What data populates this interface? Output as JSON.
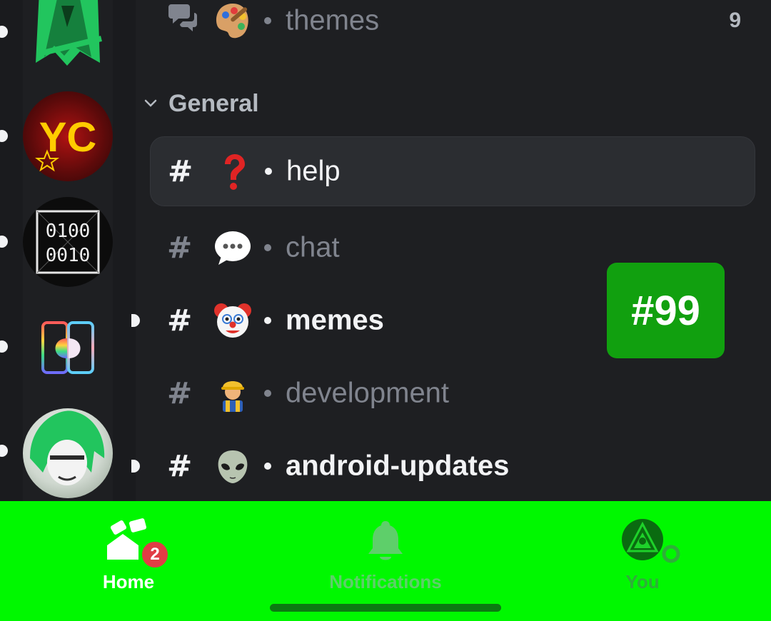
{
  "channels": [
    {
      "name": "themes",
      "emoji": "artist-palette",
      "count": "9",
      "type": "forum"
    },
    {
      "name": "help",
      "emoji": "red-question-mark",
      "type": "text",
      "selected": true
    },
    {
      "name": "chat",
      "emoji": "speech-bubble",
      "type": "text"
    },
    {
      "name": "memes",
      "emoji": "clown-face",
      "type": "text",
      "unread": true
    },
    {
      "name": "development",
      "emoji": "construction-worker",
      "type": "text"
    },
    {
      "name": "android-updates",
      "emoji": "alien",
      "type": "text",
      "unread": true
    }
  ],
  "category": {
    "label": "General"
  },
  "overlay_badge": "#99",
  "tabs": {
    "home": {
      "label": "Home",
      "badge": "2"
    },
    "notifications": {
      "label": "Notifications"
    },
    "you": {
      "label": "You"
    }
  },
  "colors": {
    "tabbar_bg": "#00f800",
    "badge_red": "#e13d45",
    "overlay_green": "#11a00f"
  }
}
